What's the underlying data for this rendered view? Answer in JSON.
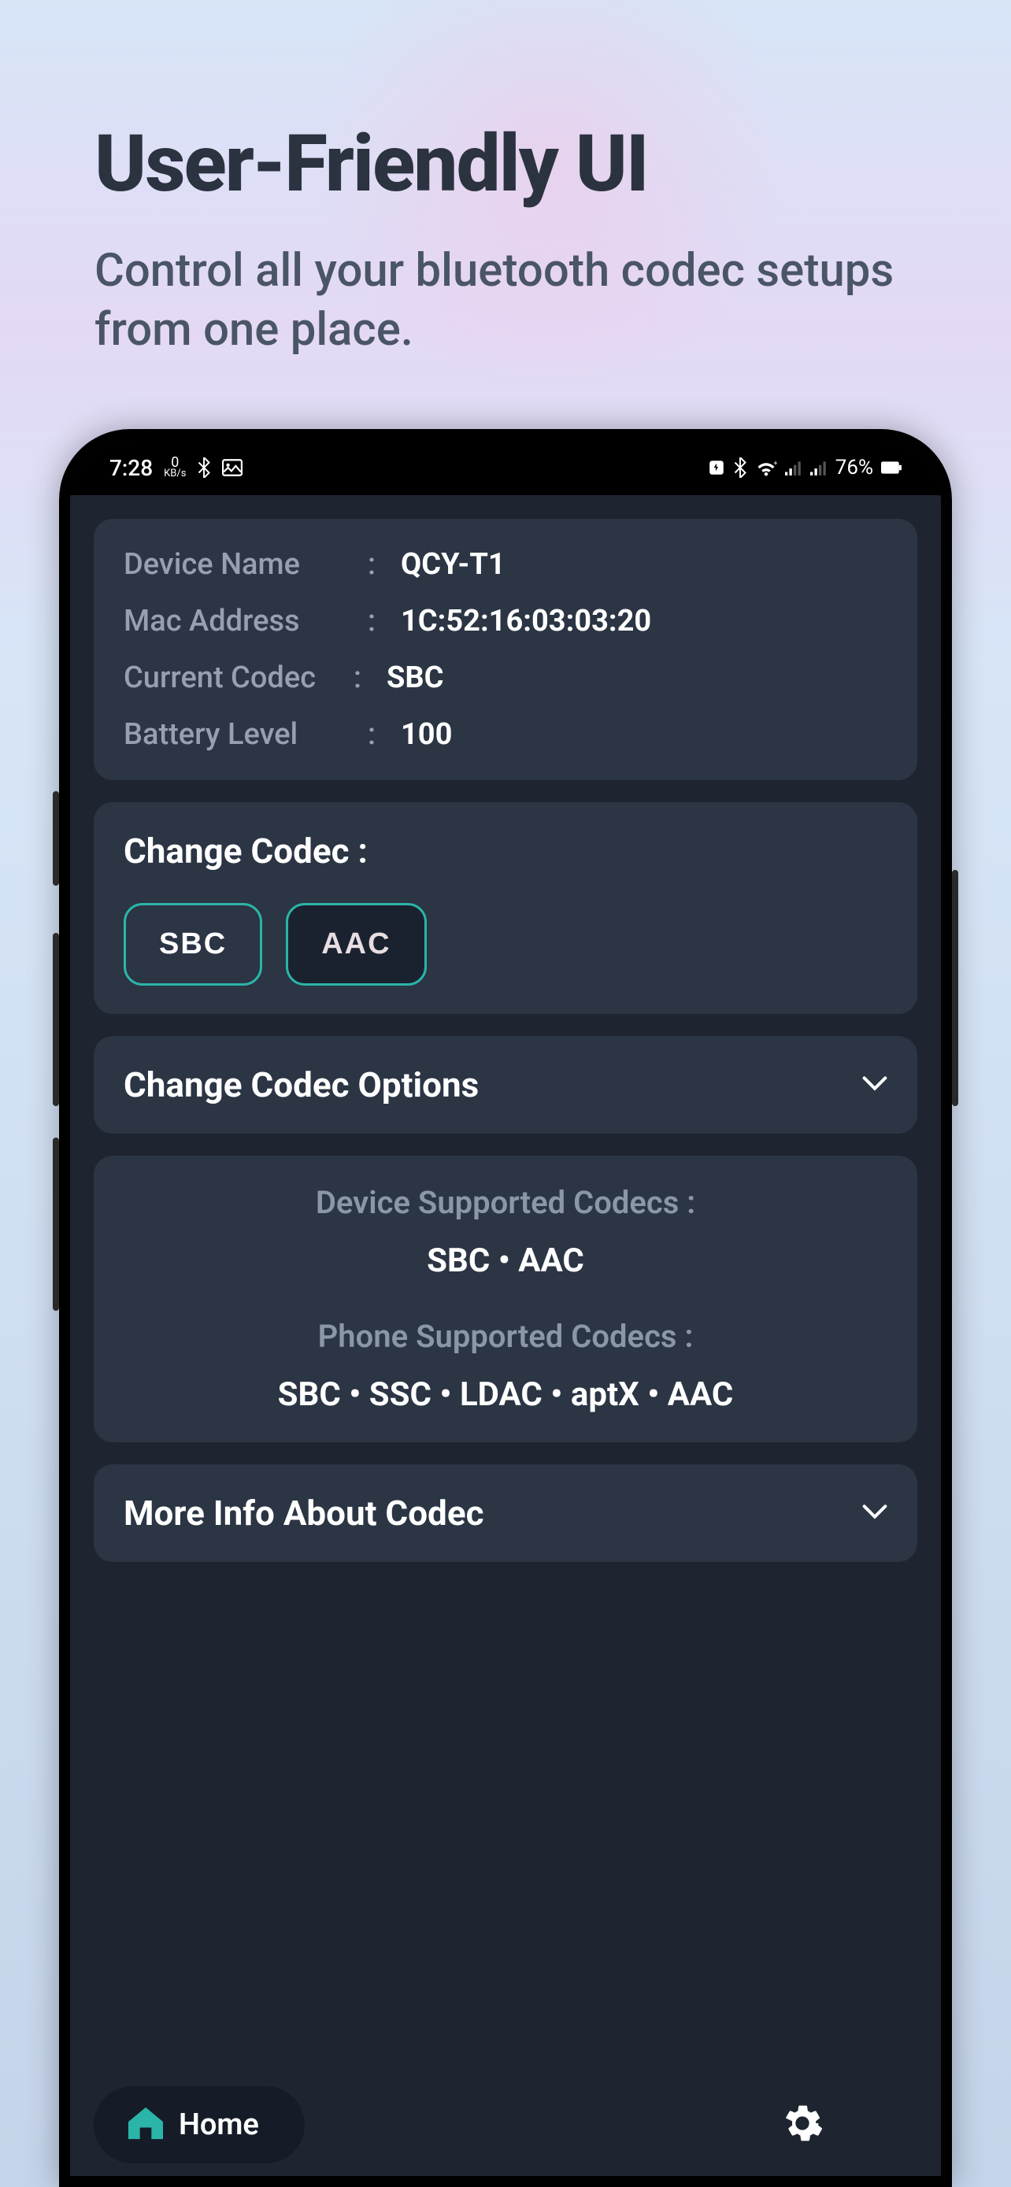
{
  "marketing": {
    "title": "User-Friendly UI",
    "subtitle": "Control all your bluetooth codec setups from one place."
  },
  "statusBar": {
    "time": "7:28",
    "kbs_num": "0",
    "kbs_unit": "KB/s",
    "battery": "76%"
  },
  "deviceInfo": {
    "name_label": "Device Name",
    "name_value": "QCY-T1",
    "mac_label": "Mac Address",
    "mac_value": "1C:52:16:03:03:20",
    "codec_label": "Current Codec",
    "codec_value": "SBC",
    "battery_label": "Battery Level",
    "battery_value": "100"
  },
  "changeCodec": {
    "title": "Change Codec :",
    "options": [
      "SBC",
      "AAC"
    ]
  },
  "expandOptions": {
    "title": "Change Codec Options"
  },
  "supported": {
    "device_label": "Device Supported Codecs :",
    "device_values": "SBC • AAC",
    "phone_label": "Phone Supported Codecs :",
    "phone_values": "SBC • SSC • LDAC • aptX • AAC"
  },
  "moreInfo": {
    "title": "More Info About Codec"
  },
  "nav": {
    "home": "Home"
  }
}
